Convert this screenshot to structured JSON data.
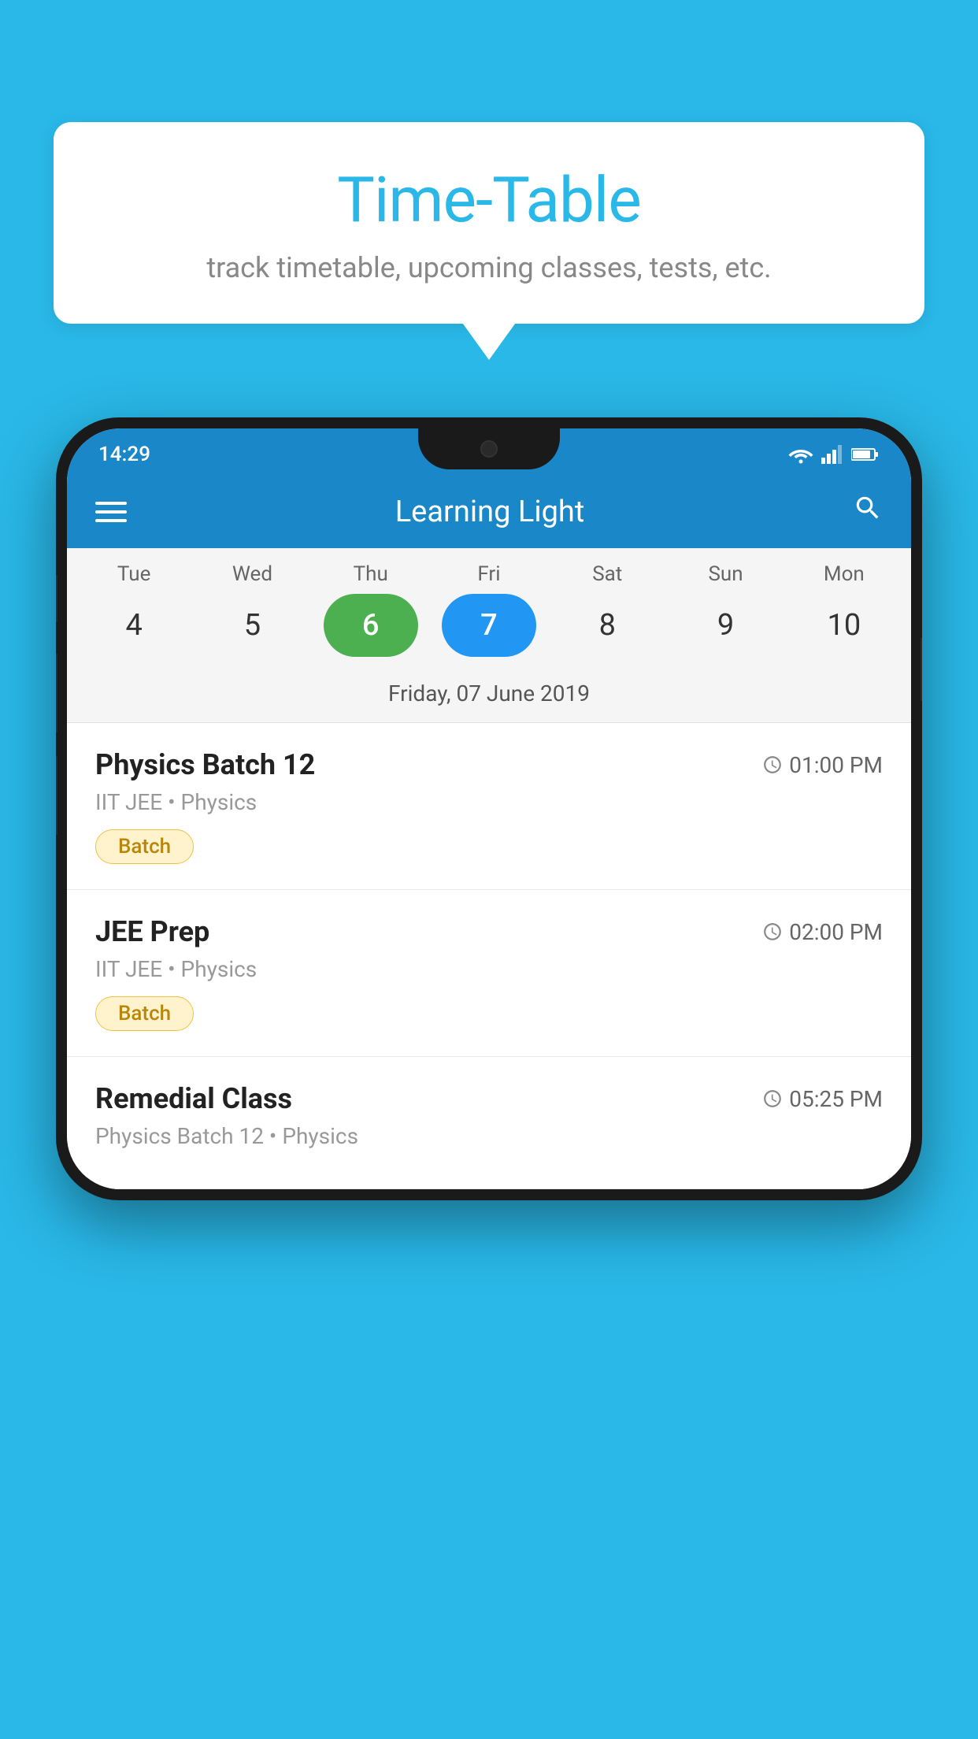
{
  "background_color": "#29b8e8",
  "bubble": {
    "title": "Time-Table",
    "subtitle": "track timetable, upcoming classes, tests, etc."
  },
  "phone": {
    "status_bar": {
      "time": "14:29"
    },
    "app_bar": {
      "title": "Learning Light"
    },
    "calendar": {
      "days": [
        {
          "label": "Tue",
          "num": "4",
          "state": "normal"
        },
        {
          "label": "Wed",
          "num": "5",
          "state": "normal"
        },
        {
          "label": "Thu",
          "num": "6",
          "state": "today"
        },
        {
          "label": "Fri",
          "num": "7",
          "state": "selected"
        },
        {
          "label": "Sat",
          "num": "8",
          "state": "normal"
        },
        {
          "label": "Sun",
          "num": "9",
          "state": "normal"
        },
        {
          "label": "Mon",
          "num": "10",
          "state": "normal"
        }
      ],
      "selected_date_label": "Friday, 07 June 2019"
    },
    "schedule": [
      {
        "title": "Physics Batch 12",
        "time": "01:00 PM",
        "subtitle": "IIT JEE • Physics",
        "badge": "Batch"
      },
      {
        "title": "JEE Prep",
        "time": "02:00 PM",
        "subtitle": "IIT JEE • Physics",
        "badge": "Batch"
      },
      {
        "title": "Remedial Class",
        "time": "05:25 PM",
        "subtitle": "Physics Batch 12 • Physics",
        "badge": null
      }
    ]
  }
}
